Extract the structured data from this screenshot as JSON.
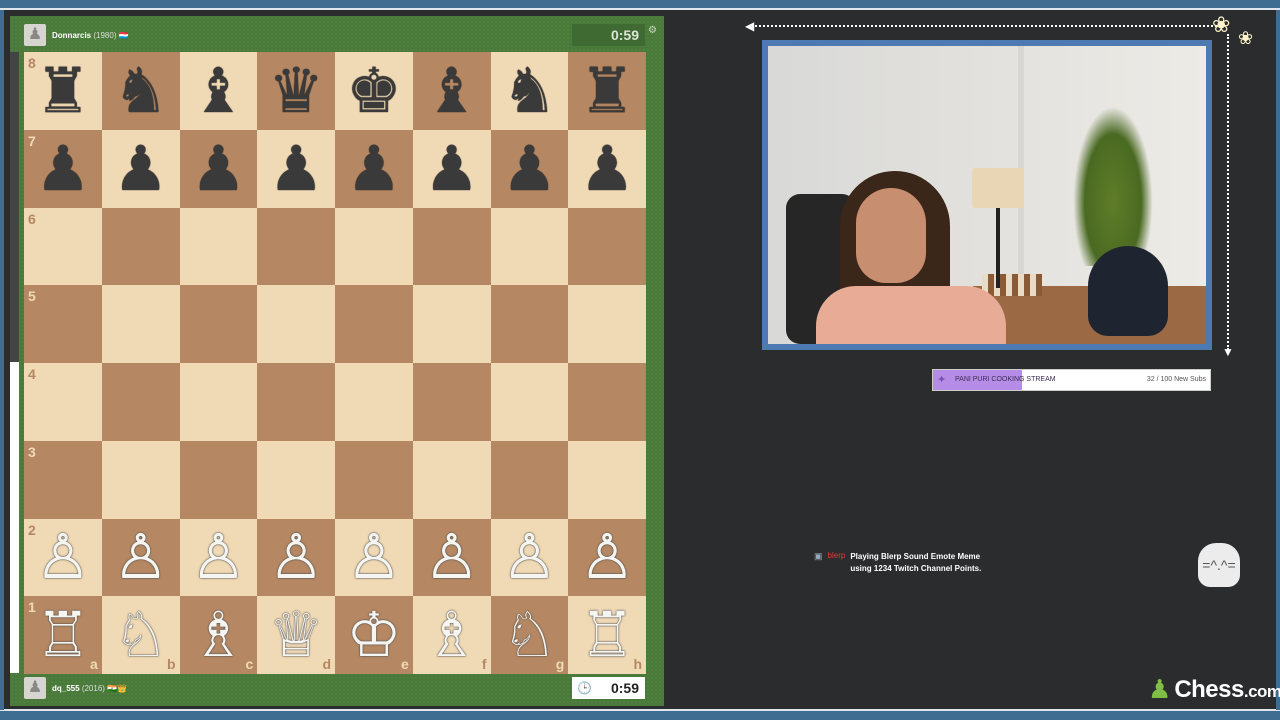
{
  "top_player": {
    "name": "Donnarcis",
    "rating": "(1980)",
    "flag": "🇱🇺",
    "clock": "0:59"
  },
  "bottom_player": {
    "name": "dq_555",
    "rating": "(2016)",
    "flag": "🇮🇳👑",
    "clock": "0:59"
  },
  "board": {
    "rows": [
      [
        "♜",
        "♞",
        "♝",
        "♛",
        "♚",
        "♝",
        "♞",
        "♜"
      ],
      [
        "♟",
        "♟",
        "♟",
        "♟",
        "♟",
        "♟",
        "♟",
        "♟"
      ],
      [
        "",
        "",
        "",
        "",
        "",
        "",
        "",
        ""
      ],
      [
        "",
        "",
        "",
        "",
        "",
        "",
        "",
        ""
      ],
      [
        "",
        "",
        "",
        "",
        "",
        "",
        "",
        ""
      ],
      [
        "",
        "",
        "",
        "",
        "",
        "",
        "",
        ""
      ],
      [
        "♙",
        "♙",
        "♙",
        "♙",
        "♙",
        "♙",
        "♙",
        "♙"
      ],
      [
        "♖",
        "♘",
        "♗",
        "♕",
        "♔",
        "♗",
        "♘",
        "♖"
      ]
    ],
    "ranks": [
      "8",
      "7",
      "6",
      "5",
      "4",
      "3",
      "2",
      "1"
    ],
    "files": [
      "a",
      "b",
      "c",
      "d",
      "e",
      "f",
      "g",
      "h"
    ]
  },
  "sub_goal": {
    "label": "PANI PURI COOKING STREAM",
    "count": "32 / 100 New Subs",
    "progress": 0.32
  },
  "alert": {
    "user": "blerp",
    "message": "Playing Blerp Sound Emote Meme using 1234 Twitch Channel Points."
  },
  "logo": {
    "text": "Chess",
    "suffix": ".com"
  },
  "icons": {
    "gear": "gear-icon",
    "clock": "clock-icon",
    "avatar": "pawn-avatar-icon"
  },
  "colors": {
    "light_square": "#f0d9b5",
    "dark_square": "#b58863",
    "panel": "#4a7a3a",
    "frame": "#3f6d91",
    "accent": "#7fbd44"
  }
}
